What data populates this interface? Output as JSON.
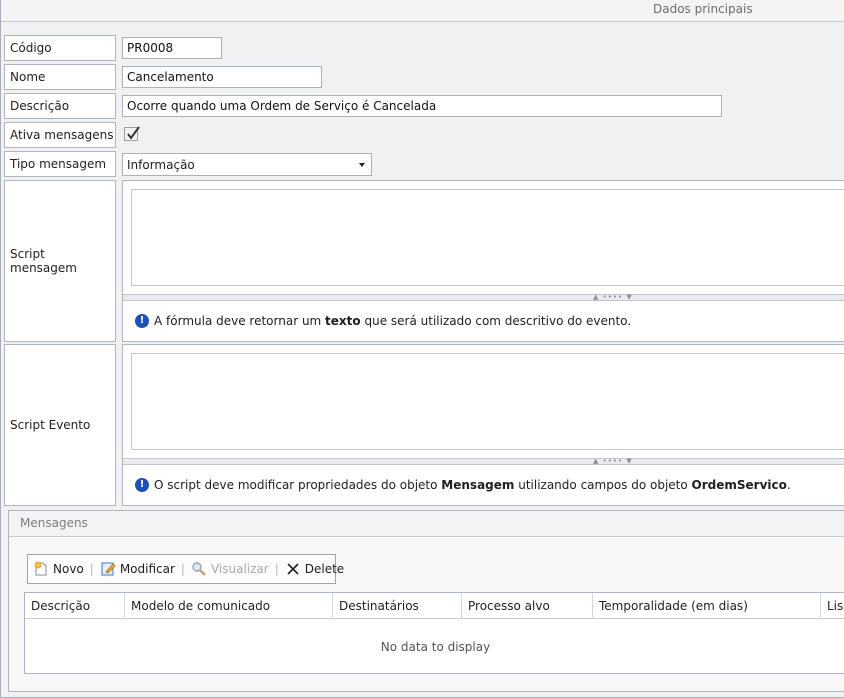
{
  "header": {
    "title": "Dados principais"
  },
  "form": {
    "codigo": {
      "label": "Código",
      "value": "PR0008"
    },
    "nome": {
      "label": "Nome",
      "value": "Cancelamento"
    },
    "descricao": {
      "label": "Descrição",
      "value": "Ocorre quando uma Ordem de Serviço é Cancelada"
    },
    "ativa_mensagens": {
      "label": "Ativa mensagens",
      "checked": true
    },
    "tipo_mensagem": {
      "label": "Tipo mensagem",
      "value": "Informação"
    },
    "script_mensagem": {
      "label": "Script mensagem",
      "value": "",
      "hint_pre": "A fórmula deve retornar um ",
      "hint_bold": "texto",
      "hint_post": " que será utilizado com descritivo do evento."
    },
    "script_evento": {
      "label": "Script Evento",
      "value": "",
      "hint_pre": "O script deve modificar propriedades do objeto ",
      "hint_bold1": "Mensagem",
      "hint_mid": " utilizando campos do objeto ",
      "hint_bold2": "OrdemServico",
      "hint_post": "."
    }
  },
  "messages": {
    "title": "Mensagens",
    "toolbar": {
      "novo": "Novo",
      "modificar": "Modificar",
      "visualizar": "Visualizar",
      "delete": "Delete",
      "separator": "|"
    },
    "grid": {
      "columns": [
        "Descrição",
        "Modelo de comunicado",
        "Destinatários",
        "Processo alvo",
        "Temporalidade (em dias)",
        "Lis"
      ],
      "empty_text": "No data to display"
    }
  },
  "icons": {
    "info": "info-icon",
    "new": "new-document-icon",
    "edit": "edit-icon",
    "view": "magnifier-icon",
    "delete": "delete-x-icon",
    "dropdown": "chevron-down-icon",
    "checkmark": "checkmark-icon"
  },
  "colors": {
    "info_blue": "#1f4fb9",
    "border": "#aeb5be",
    "background": "#f0f1f3"
  }
}
